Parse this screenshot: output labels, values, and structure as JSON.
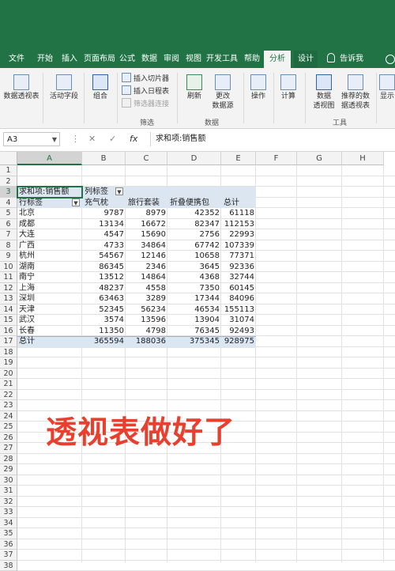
{
  "tabs": [
    {
      "label": "文件"
    },
    {
      "label": "开始"
    },
    {
      "label": "插入"
    },
    {
      "label": "页面布局"
    },
    {
      "label": "公式"
    },
    {
      "label": "数据"
    },
    {
      "label": "审阅"
    },
    {
      "label": "视图"
    },
    {
      "label": "开发工具"
    },
    {
      "label": "帮助"
    },
    {
      "label": "分析"
    },
    {
      "label": "设计"
    }
  ],
  "tell_me": "告诉我",
  "ribbon": {
    "pivot_table": "数据透视表",
    "active_field": "活动字段",
    "group": "组合",
    "insert_slicer": "插入切片器",
    "insert_timeline": "插入日程表",
    "filter_connections": "筛选器连接",
    "filter_group": "筛选",
    "refresh": "刷新",
    "change_source_1": "更改",
    "change_source_2": "数据源",
    "data_group": "数据",
    "actions": "操作",
    "calculations": "计算",
    "pivot_chart_1": "数据",
    "pivot_chart_2": "透视图",
    "recommended_1": "推荐的数",
    "recommended_2": "据透视表",
    "tools_group": "工具",
    "show": "显示"
  },
  "formula_bar": {
    "name_box": "A3",
    "formula": "求和项:销售额"
  },
  "columns": [
    "A",
    "B",
    "C",
    "D",
    "E",
    "F",
    "G",
    "H"
  ],
  "rows": [
    "1",
    "2",
    "3",
    "4",
    "5",
    "6",
    "7",
    "8",
    "9",
    "10",
    "11",
    "12",
    "13",
    "14",
    "15",
    "16",
    "17",
    "18",
    "19",
    "20",
    "21",
    "22",
    "23",
    "24",
    "25",
    "26",
    "27",
    "28",
    "29",
    "30",
    "31",
    "32",
    "33",
    "34",
    "35",
    "36",
    "37",
    "38"
  ],
  "pivot": {
    "value_label": "求和项:销售额",
    "col_label": "列标签",
    "row_label": "行标签",
    "headers": [
      "充气枕",
      "旅行套装",
      "折叠便携包",
      "总计"
    ],
    "rows": [
      {
        "city": "北京",
        "v": [
          "9787",
          "8979",
          "42352",
          "61118"
        ]
      },
      {
        "city": "成都",
        "v": [
          "13134",
          "16672",
          "82347",
          "112153"
        ]
      },
      {
        "city": "大连",
        "v": [
          "4547",
          "15690",
          "2756",
          "22993"
        ]
      },
      {
        "city": "广西",
        "v": [
          "4733",
          "34864",
          "67742",
          "107339"
        ]
      },
      {
        "city": "杭州",
        "v": [
          "54567",
          "12146",
          "10658",
          "77371"
        ]
      },
      {
        "city": "湖南",
        "v": [
          "86345",
          "2346",
          "3645",
          "92336"
        ]
      },
      {
        "city": "南宁",
        "v": [
          "13512",
          "14864",
          "4368",
          "32744"
        ]
      },
      {
        "city": "上海",
        "v": [
          "48237",
          "4558",
          "7350",
          "60145"
        ]
      },
      {
        "city": "深圳",
        "v": [
          "63463",
          "3289",
          "17344",
          "84096"
        ]
      },
      {
        "city": "天津",
        "v": [
          "52345",
          "56234",
          "46534",
          "155113"
        ]
      },
      {
        "city": "武汉",
        "v": [
          "3574",
          "13596",
          "13904",
          "31074"
        ]
      },
      {
        "city": "长春",
        "v": [
          "11350",
          "4798",
          "76345",
          "92493"
        ]
      }
    ],
    "total_label": "总计",
    "totals": [
      "365594",
      "188036",
      "375345",
      "928975"
    ]
  },
  "overlay_text": "透视表做好了",
  "colors": {
    "excel_green": "#217346",
    "pivot_blue": "#dce6f1",
    "overlay_red": "#e8402f"
  }
}
